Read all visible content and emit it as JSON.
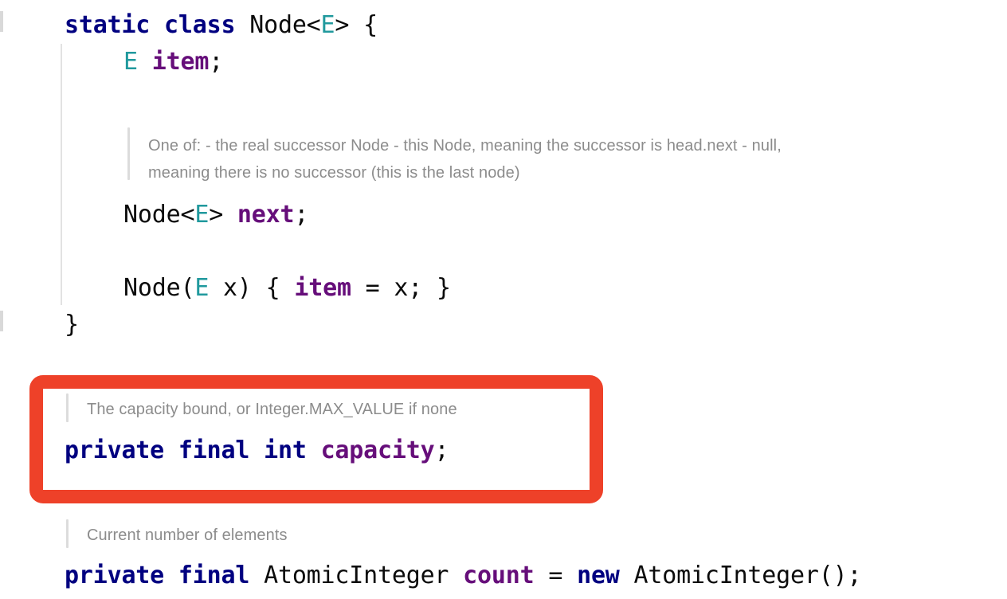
{
  "editor": {
    "language": "java",
    "background_color": "#ffffff",
    "colors": {
      "keyword": "#000080",
      "field": "#660e7a",
      "type_parameter": "#20999d",
      "plain_text": "#0b0b0b",
      "doc_comment": "#8c8c8c",
      "indent_guide": "#e2e2e2",
      "doc_bar": "#dcdcdc",
      "highlight": "#ee4129"
    }
  },
  "code": {
    "line_1": {
      "tok_static": "static",
      "tok_space_1": " ",
      "tok_class": "class",
      "tok_space_2": " ",
      "tok_node": "Node<",
      "tok_E": "E",
      "tok_tail": "> {"
    },
    "line_2": {
      "tok_E": "E",
      "tok_space": " ",
      "tok_item": "item",
      "tok_semi": ";"
    },
    "line_3": {
      "tok_node": "Node<",
      "tok_E": "E",
      "tok_gt": "> ",
      "tok_next": "next",
      "tok_semi": ";"
    },
    "line_4": {
      "tok_node_open": "Node(",
      "tok_E": "E",
      "tok_x": " x) { ",
      "tok_item": "item",
      "tok_tail": " = x; }"
    },
    "line_5": {
      "tok_close_brace": "}"
    },
    "line_6": {
      "tok_private": "private",
      "tok_space_1": " ",
      "tok_final": "final",
      "tok_space_2": " ",
      "tok_int": "int",
      "tok_space_3": " ",
      "tok_capacity": "capacity",
      "tok_semi": ";"
    },
    "line_7": {
      "tok_private": "private",
      "tok_space_1": " ",
      "tok_final": "final",
      "tok_space_2": " ",
      "tok_atomicinteger": "AtomicInteger",
      "tok_space_3": " ",
      "tok_count": "count",
      "tok_eq": " = ",
      "tok_new": "new",
      "tok_ctor": " AtomicInteger();"
    }
  },
  "doc_comments": {
    "next_field": {
      "line_1": "One of: - the real successor Node - this Node, meaning the successor is head.next - null,",
      "line_2": "meaning there is no successor (this is the last node)"
    },
    "capacity_field": {
      "line_1": "The capacity bound, or Integer.MAX_VALUE if none"
    },
    "count_field": {
      "line_1": "Current number of elements"
    }
  },
  "annotation": {
    "highlight_label": "capacity-field-highlight",
    "color": "#ee4129"
  }
}
